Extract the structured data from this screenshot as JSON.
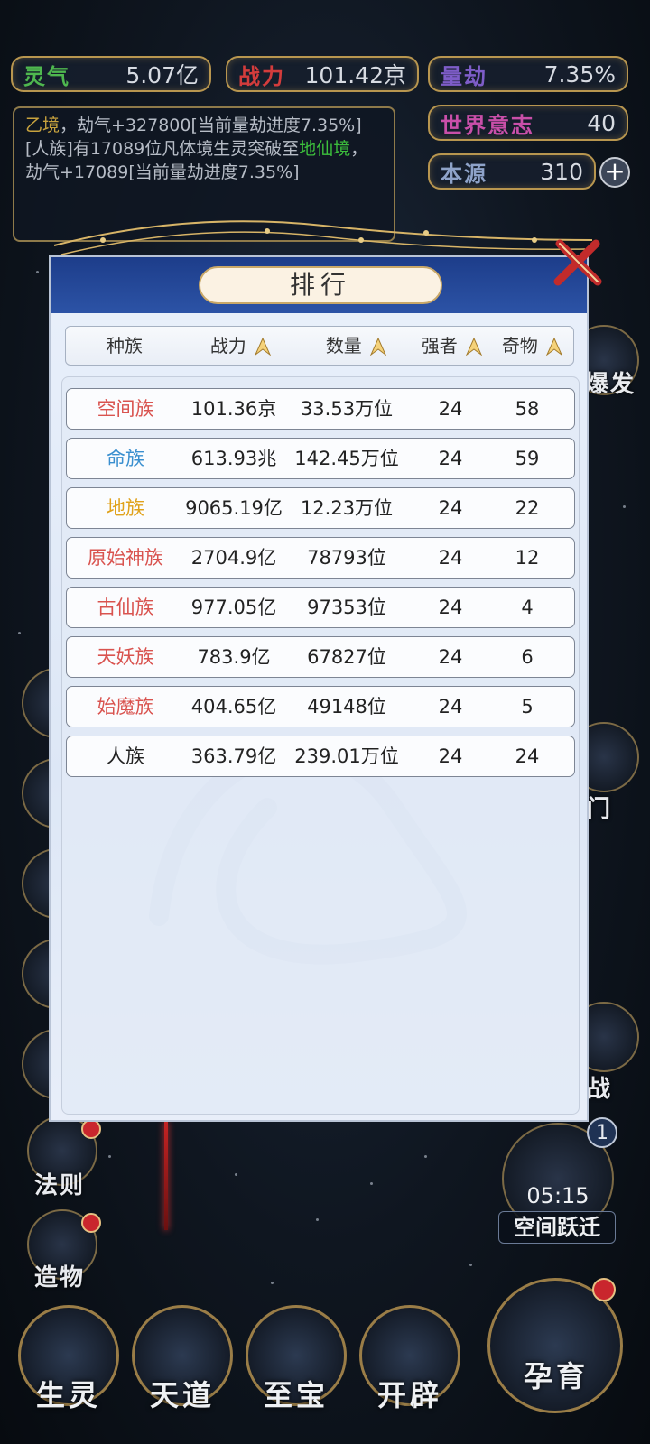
{
  "top_bar": {
    "lingqi": {
      "label": "灵气",
      "value": "5.07亿",
      "color": "#4fb84f"
    },
    "zhanli": {
      "label": "战力",
      "value": "101.42京",
      "color": "#d33c3c"
    },
    "liangjie": {
      "label": "量劫",
      "value": "7.35%",
      "color": "#7e5dc8"
    },
    "shijie": {
      "label": "世界意志",
      "value": "40",
      "color": "#c94fa9"
    },
    "benyuan": {
      "label": "本源",
      "value": "310",
      "color": "#8ea3c9"
    }
  },
  "log": {
    "line1_a": "乙境",
    "line1_b": "，劫气+327800[当前量劫进度7.35%]",
    "line2_a": "[人族]有17089位凡体境生灵突破至",
    "line2_b": "地仙境",
    "line2_c": "，劫气+17089[当前量劫进度7.35%]"
  },
  "side_partial_labels": [
    "爆发",
    "门",
    "战"
  ],
  "left_buttons": [
    {
      "label": "法则"
    },
    {
      "label": "造物"
    }
  ],
  "space_jump": {
    "badge": "1",
    "timer": "05:15",
    "label": "空间跃迁"
  },
  "bottom_nav": [
    {
      "label": "生灵"
    },
    {
      "label": "天道"
    },
    {
      "label": "至宝"
    },
    {
      "label": "开辟"
    },
    {
      "label": "孕育"
    }
  ],
  "modal": {
    "title": "排行",
    "headers": [
      "种族",
      "战力",
      "数量",
      "强者",
      "奇物"
    ],
    "rows": [
      {
        "race": "空间族",
        "color": "#d9534f",
        "power": "101.36京",
        "count": "33.53万位",
        "strong": "24",
        "items": "58"
      },
      {
        "race": "命族",
        "color": "#3a8fcf",
        "power": "613.93兆",
        "count": "142.45万位",
        "strong": "24",
        "items": "59"
      },
      {
        "race": "地族",
        "color": "#e0a21b",
        "power": "9065.19亿",
        "count": "12.23万位",
        "strong": "24",
        "items": "22"
      },
      {
        "race": "原始神族",
        "color": "#d9534f",
        "power": "2704.9亿",
        "count": "78793位",
        "strong": "24",
        "items": "12"
      },
      {
        "race": "古仙族",
        "color": "#d9534f",
        "power": "977.05亿",
        "count": "97353位",
        "strong": "24",
        "items": "4"
      },
      {
        "race": "天妖族",
        "color": "#d9534f",
        "power": "783.9亿",
        "count": "67827位",
        "strong": "24",
        "items": "6"
      },
      {
        "race": "始魔族",
        "color": "#d9534f",
        "power": "404.65亿",
        "count": "49148位",
        "strong": "24",
        "items": "5"
      },
      {
        "race": "人族",
        "color": "#222222",
        "power": "363.79亿",
        "count": "239.01万位",
        "strong": "24",
        "items": "24"
      }
    ]
  }
}
